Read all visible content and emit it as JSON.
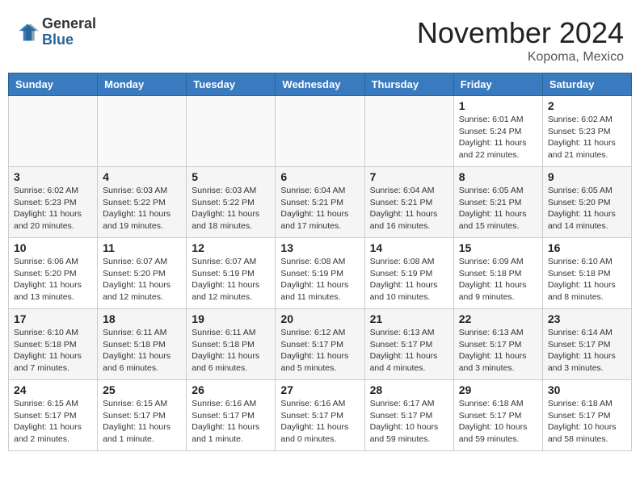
{
  "header": {
    "logo_line1": "General",
    "logo_line2": "Blue",
    "month": "November 2024",
    "location": "Kopoma, Mexico"
  },
  "weekdays": [
    "Sunday",
    "Monday",
    "Tuesday",
    "Wednesday",
    "Thursday",
    "Friday",
    "Saturday"
  ],
  "weeks": [
    [
      {
        "day": "",
        "info": ""
      },
      {
        "day": "",
        "info": ""
      },
      {
        "day": "",
        "info": ""
      },
      {
        "day": "",
        "info": ""
      },
      {
        "day": "",
        "info": ""
      },
      {
        "day": "1",
        "info": "Sunrise: 6:01 AM\nSunset: 5:24 PM\nDaylight: 11 hours\nand 22 minutes."
      },
      {
        "day": "2",
        "info": "Sunrise: 6:02 AM\nSunset: 5:23 PM\nDaylight: 11 hours\nand 21 minutes."
      }
    ],
    [
      {
        "day": "3",
        "info": "Sunrise: 6:02 AM\nSunset: 5:23 PM\nDaylight: 11 hours\nand 20 minutes."
      },
      {
        "day": "4",
        "info": "Sunrise: 6:03 AM\nSunset: 5:22 PM\nDaylight: 11 hours\nand 19 minutes."
      },
      {
        "day": "5",
        "info": "Sunrise: 6:03 AM\nSunset: 5:22 PM\nDaylight: 11 hours\nand 18 minutes."
      },
      {
        "day": "6",
        "info": "Sunrise: 6:04 AM\nSunset: 5:21 PM\nDaylight: 11 hours\nand 17 minutes."
      },
      {
        "day": "7",
        "info": "Sunrise: 6:04 AM\nSunset: 5:21 PM\nDaylight: 11 hours\nand 16 minutes."
      },
      {
        "day": "8",
        "info": "Sunrise: 6:05 AM\nSunset: 5:21 PM\nDaylight: 11 hours\nand 15 minutes."
      },
      {
        "day": "9",
        "info": "Sunrise: 6:05 AM\nSunset: 5:20 PM\nDaylight: 11 hours\nand 14 minutes."
      }
    ],
    [
      {
        "day": "10",
        "info": "Sunrise: 6:06 AM\nSunset: 5:20 PM\nDaylight: 11 hours\nand 13 minutes."
      },
      {
        "day": "11",
        "info": "Sunrise: 6:07 AM\nSunset: 5:20 PM\nDaylight: 11 hours\nand 12 minutes."
      },
      {
        "day": "12",
        "info": "Sunrise: 6:07 AM\nSunset: 5:19 PM\nDaylight: 11 hours\nand 12 minutes."
      },
      {
        "day": "13",
        "info": "Sunrise: 6:08 AM\nSunset: 5:19 PM\nDaylight: 11 hours\nand 11 minutes."
      },
      {
        "day": "14",
        "info": "Sunrise: 6:08 AM\nSunset: 5:19 PM\nDaylight: 11 hours\nand 10 minutes."
      },
      {
        "day": "15",
        "info": "Sunrise: 6:09 AM\nSunset: 5:18 PM\nDaylight: 11 hours\nand 9 minutes."
      },
      {
        "day": "16",
        "info": "Sunrise: 6:10 AM\nSunset: 5:18 PM\nDaylight: 11 hours\nand 8 minutes."
      }
    ],
    [
      {
        "day": "17",
        "info": "Sunrise: 6:10 AM\nSunset: 5:18 PM\nDaylight: 11 hours\nand 7 minutes."
      },
      {
        "day": "18",
        "info": "Sunrise: 6:11 AM\nSunset: 5:18 PM\nDaylight: 11 hours\nand 6 minutes."
      },
      {
        "day": "19",
        "info": "Sunrise: 6:11 AM\nSunset: 5:18 PM\nDaylight: 11 hours\nand 6 minutes."
      },
      {
        "day": "20",
        "info": "Sunrise: 6:12 AM\nSunset: 5:17 PM\nDaylight: 11 hours\nand 5 minutes."
      },
      {
        "day": "21",
        "info": "Sunrise: 6:13 AM\nSunset: 5:17 PM\nDaylight: 11 hours\nand 4 minutes."
      },
      {
        "day": "22",
        "info": "Sunrise: 6:13 AM\nSunset: 5:17 PM\nDaylight: 11 hours\nand 3 minutes."
      },
      {
        "day": "23",
        "info": "Sunrise: 6:14 AM\nSunset: 5:17 PM\nDaylight: 11 hours\nand 3 minutes."
      }
    ],
    [
      {
        "day": "24",
        "info": "Sunrise: 6:15 AM\nSunset: 5:17 PM\nDaylight: 11 hours\nand 2 minutes."
      },
      {
        "day": "25",
        "info": "Sunrise: 6:15 AM\nSunset: 5:17 PM\nDaylight: 11 hours\nand 1 minute."
      },
      {
        "day": "26",
        "info": "Sunrise: 6:16 AM\nSunset: 5:17 PM\nDaylight: 11 hours\nand 1 minute."
      },
      {
        "day": "27",
        "info": "Sunrise: 6:16 AM\nSunset: 5:17 PM\nDaylight: 11 hours\nand 0 minutes."
      },
      {
        "day": "28",
        "info": "Sunrise: 6:17 AM\nSunset: 5:17 PM\nDaylight: 10 hours\nand 59 minutes."
      },
      {
        "day": "29",
        "info": "Sunrise: 6:18 AM\nSunset: 5:17 PM\nDaylight: 10 hours\nand 59 minutes."
      },
      {
        "day": "30",
        "info": "Sunrise: 6:18 AM\nSunset: 5:17 PM\nDaylight: 10 hours\nand 58 minutes."
      }
    ]
  ]
}
